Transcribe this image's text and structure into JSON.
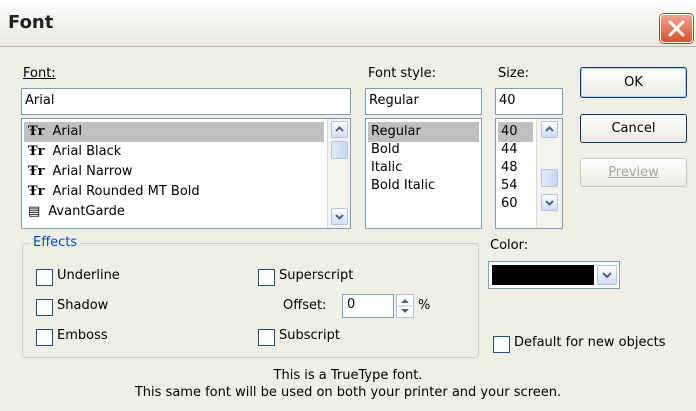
{
  "window": {
    "title": "Font"
  },
  "font": {
    "label": "Font:",
    "value": "Arial",
    "items": [
      "Arial",
      "Arial Black",
      "Arial Narrow",
      "Arial Rounded MT Bold",
      "AvantGarde"
    ],
    "selected": "Arial",
    "icons": [
      "truetype-icon",
      "truetype-icon",
      "truetype-icon",
      "truetype-icon",
      "printer-font-icon"
    ]
  },
  "font_style": {
    "label": "Font style:",
    "value": "Regular",
    "items": [
      "Regular",
      "Bold",
      "Italic",
      "Bold Italic"
    ],
    "selected": "Regular"
  },
  "size": {
    "label": "Size:",
    "value": "40",
    "items": [
      "40",
      "44",
      "48",
      "54",
      "60"
    ],
    "selected": "40"
  },
  "buttons": {
    "ok": "OK",
    "cancel": "Cancel",
    "preview": "Preview"
  },
  "effects": {
    "label": "Effects",
    "underline": "Underline",
    "shadow": "Shadow",
    "emboss": "Emboss",
    "superscript": "Superscript",
    "subscript": "Subscript",
    "offset_label": "Offset:",
    "offset_value": "0",
    "offset_unit": "%"
  },
  "color": {
    "label": "Color:",
    "value": "#000000"
  },
  "default_checkbox": "Default for new objects",
  "info": {
    "line1": "This is a TrueType font.",
    "line2": "This same font will be used on both your printer and your screen."
  },
  "colors": {
    "selection": "#c0c0c0",
    "group_label": "#0046d5",
    "close": "#d9502e"
  }
}
